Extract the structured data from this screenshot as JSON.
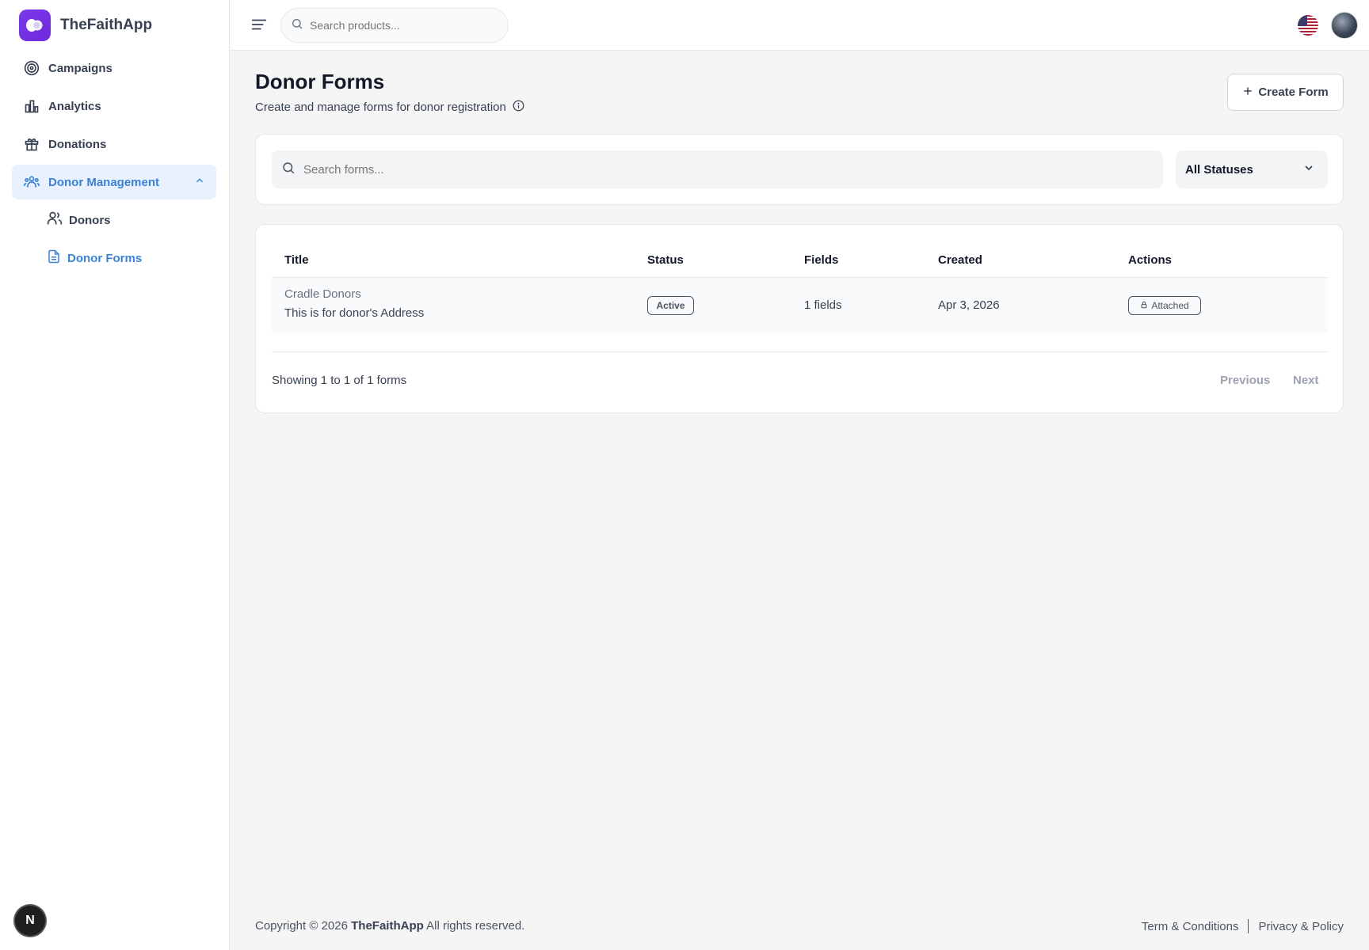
{
  "app": {
    "name": "TheFaithApp"
  },
  "sidebar": {
    "items": [
      {
        "label": "Campaigns",
        "icon": "target-icon"
      },
      {
        "label": "Analytics",
        "icon": "bar-chart-icon"
      },
      {
        "label": "Donations",
        "icon": "gift-icon"
      },
      {
        "label": "Donor Management",
        "icon": "users-icon",
        "expanded": true
      }
    ],
    "subitems": [
      {
        "label": "Donors",
        "icon": "users-icon"
      },
      {
        "label": "Donor Forms",
        "icon": "file-icon",
        "active": true
      }
    ],
    "badge_letter": "N"
  },
  "header": {
    "search_placeholder": "Search products..."
  },
  "page": {
    "title": "Donor Forms",
    "subtitle": "Create and manage forms for donor registration",
    "create_label": "Create Form"
  },
  "filters": {
    "search_placeholder": "Search forms...",
    "status_value": "All Statuses"
  },
  "table": {
    "columns": [
      "Title",
      "Status",
      "Fields",
      "Created",
      "Actions"
    ],
    "rows": [
      {
        "title": "Cradle Donors",
        "description": "This is for donor's Address",
        "status": "Active",
        "fields": "1 fields",
        "created": "Apr 3, 2026",
        "action": "Attached"
      }
    ],
    "summary": "Showing 1 to 1 of 1 forms",
    "prev_label": "Previous",
    "next_label": "Next"
  },
  "footer": {
    "copyright_prefix": "Copyright © 2026",
    "brand": "TheFaithApp",
    "copyright_suffix": "All rights reserved.",
    "terms": "Term & Conditions",
    "privacy": "Privacy & Policy"
  },
  "colors": {
    "accent": "#3b82d6",
    "brand": "#7c3aed",
    "active_bg": "#e8f1fd"
  }
}
